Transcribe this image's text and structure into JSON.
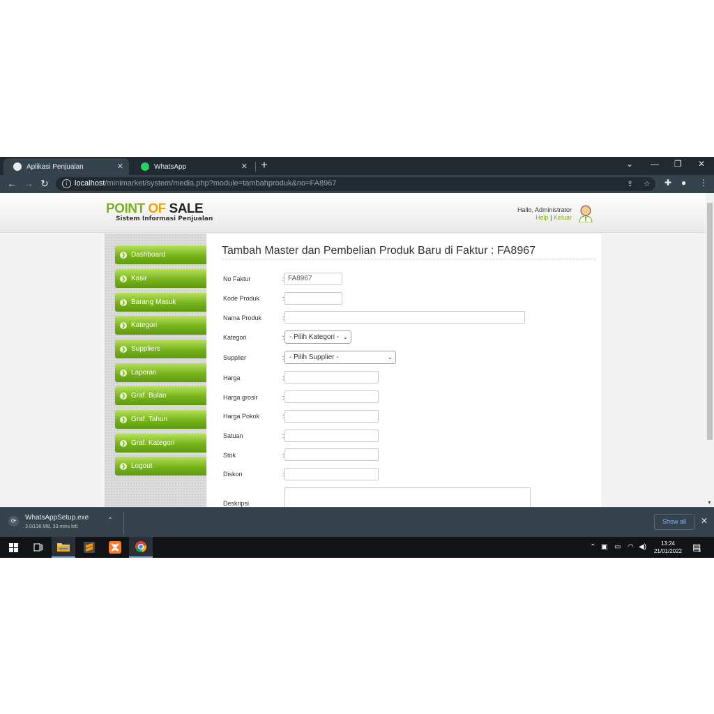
{
  "browser": {
    "tabs": [
      {
        "title": "Aplikasi Penjualan",
        "active": true
      },
      {
        "title": "WhatsApp",
        "active": false
      }
    ],
    "new_tab": "+",
    "tab_close": "✕",
    "url_host": "localhost",
    "url_path": "/minimarket/system/media.php?module=tambahproduk&no=FA8967"
  },
  "header": {
    "logo_part1": "POINT",
    "logo_part2": "OF",
    "logo_part3": "SALE",
    "subtitle": "Sistem Informasi Penjualan",
    "greeting": "Hallo, Administrator",
    "help_link": "Help",
    "logout_link": "Keluar",
    "link_separator": "|"
  },
  "sidebar": {
    "items": [
      {
        "label": "Dashboard"
      },
      {
        "label": "Kasir"
      },
      {
        "label": "Barang Masuk"
      },
      {
        "label": "Kategori"
      },
      {
        "label": "Suppliers"
      },
      {
        "label": "Laporan"
      },
      {
        "label": "Graf. Bulan"
      },
      {
        "label": "Graf. Tahun"
      },
      {
        "label": "Graf. Kategori"
      },
      {
        "label": "Logout"
      }
    ]
  },
  "form": {
    "title": "Tambah Master dan Pembelian Produk Baru di Faktur : FA8967",
    "colon": ":",
    "fields": {
      "no_faktur": {
        "label": "No Faktur",
        "value": "FA8967"
      },
      "kode_produk": {
        "label": "Kode Produk",
        "value": ""
      },
      "nama_produk": {
        "label": "Nama Produk",
        "value": ""
      },
      "kategori": {
        "label": "Kategori",
        "value": "- Pilih Kategori -"
      },
      "supplier": {
        "label": "Supplier",
        "value": "- Pilih Supplier -"
      },
      "harga": {
        "label": "Harga",
        "value": ""
      },
      "harga_grosir": {
        "label": "Harga grosir",
        "value": ""
      },
      "harga_pokok": {
        "label": "Harga Pokok",
        "value": ""
      },
      "satuan": {
        "label": "Satuan",
        "value": ""
      },
      "stok": {
        "label": "Stok",
        "value": ""
      },
      "diskon": {
        "label": "Diskon",
        "value": ""
      },
      "deskripsi": {
        "label": "Deskripsi",
        "value": ""
      }
    }
  },
  "download": {
    "filename": "WhatsAppSetup.exe",
    "status": "3.0/138 MB, 33 mins left",
    "show_all": "Show all"
  },
  "taskbar": {
    "time": "13:24",
    "date": "21/01/2022",
    "notification_count": "4"
  },
  "colors": {
    "accent_green": "#7ab317",
    "logo_orange": "#f0a400",
    "chrome_dark": "#202a30"
  }
}
